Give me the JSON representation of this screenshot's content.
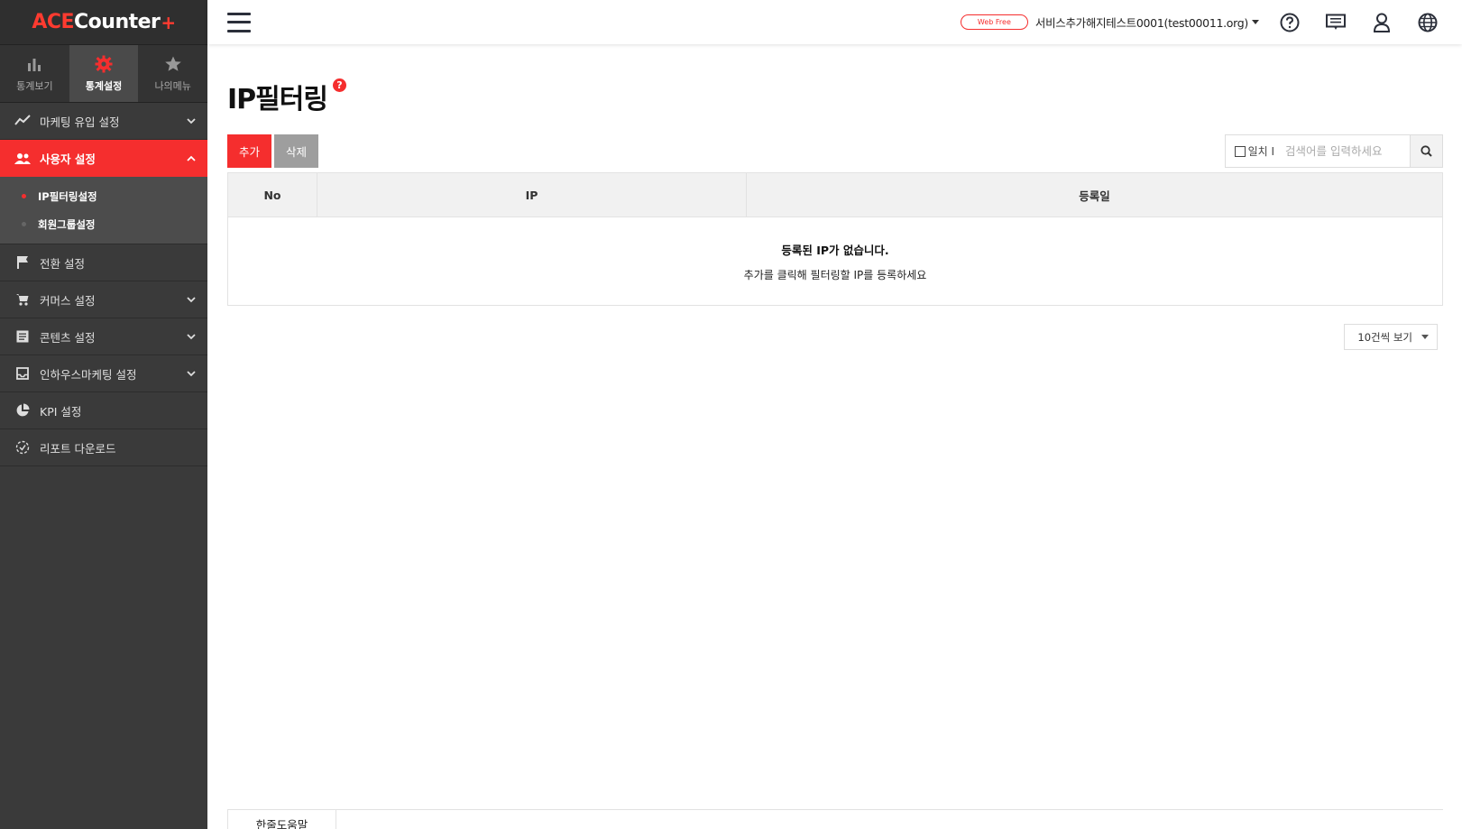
{
  "logo": {
    "ace": "ACE",
    "counter": "Counter",
    "plus": "+"
  },
  "top_tabs": [
    {
      "label": "통계보기",
      "icon": "bar-chart-icon"
    },
    {
      "label": "통계설정",
      "icon": "gear-icon",
      "active": true
    },
    {
      "label": "나의메뉴",
      "icon": "star-icon"
    }
  ],
  "sidebar": {
    "items": [
      {
        "label": "마케팅 유입 설정",
        "icon": "trend-line-icon"
      },
      {
        "label": "사용자 설정",
        "icon": "users-icon"
      },
      {
        "label": "전환 설정",
        "icon": "flag-icon"
      },
      {
        "label": "커머스 설정",
        "icon": "cart-icon"
      },
      {
        "label": "콘텐츠 설정",
        "icon": "document-icon"
      },
      {
        "label": "인하우스마케팅 설정",
        "icon": "inbox-icon"
      },
      {
        "label": "KPI 설정",
        "icon": "pie-chart-icon"
      },
      {
        "label": "리포트 다운로드",
        "icon": "download-icon"
      }
    ],
    "submenu": [
      {
        "label": "IP필터링설정"
      },
      {
        "label": "회원그룹설정"
      }
    ]
  },
  "header": {
    "badge": "Web Free",
    "account": "서비스추가해지테스트0001(test00011.org)"
  },
  "page": {
    "title": "IP필터링",
    "help": "?"
  },
  "toolbar": {
    "add_label": "추가",
    "delete_label": "삭제",
    "match_label": "일치 I",
    "search_placeholder": "검색어를 입력하세요"
  },
  "table": {
    "headers": [
      "No",
      "IP",
      "등록일"
    ],
    "empty_title": "등록된 IP가 없습니다.",
    "empty_sub": "추가를 클릭해 필터링할 IP를 등록하세요"
  },
  "pager": {
    "page_size": "10건씩 보기"
  },
  "bottom": {
    "tab_label": "한줄도움말"
  },
  "colors": {
    "accent": "#f52e2e",
    "sidebar_bg": "#3a3a3a"
  }
}
